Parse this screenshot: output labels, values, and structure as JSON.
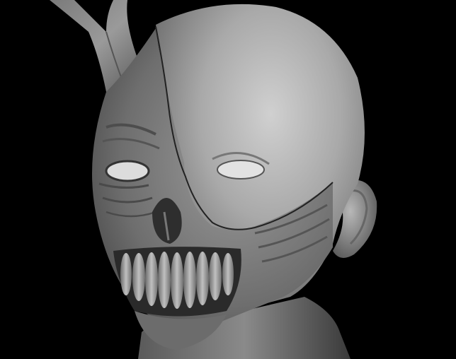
{
  "scene": {
    "background_color": "#000000",
    "clay_color": "#9a9a9a",
    "clay_highlight": "#c9c9c9",
    "clay_shadow": "#3a3a3a",
    "subject": "sculpted-head-half-skull-demon"
  }
}
